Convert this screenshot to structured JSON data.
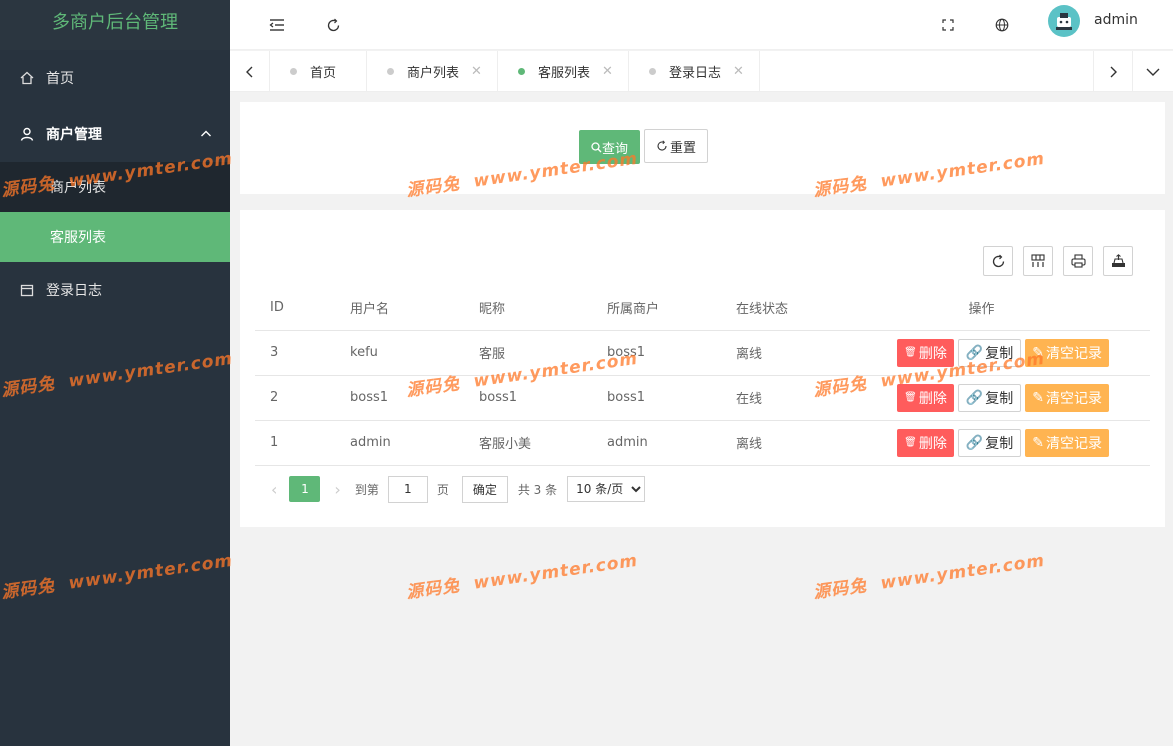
{
  "app": {
    "title": "多商户后台管理"
  },
  "sidebar": {
    "items": [
      {
        "label": "首页",
        "icon": "home-icon"
      },
      {
        "label": "商户管理",
        "icon": "user-icon",
        "expanded": true,
        "children": [
          {
            "label": "商户列表"
          },
          {
            "label": "客服列表",
            "active": true
          }
        ]
      },
      {
        "label": "登录日志",
        "icon": "calendar-icon"
      }
    ]
  },
  "header": {
    "username": "admin"
  },
  "tabs": [
    {
      "label": "首页",
      "closable": false
    },
    {
      "label": "商户列表",
      "closable": true
    },
    {
      "label": "客服列表",
      "closable": true,
      "active": true
    },
    {
      "label": "登录日志",
      "closable": true
    }
  ],
  "search": {
    "query_label": "查询",
    "reset_label": "重置"
  },
  "table": {
    "columns": [
      "ID",
      "用户名",
      "昵称",
      "所属商户",
      "在线状态",
      "操作"
    ],
    "rows": [
      {
        "id": "3",
        "username": "kefu",
        "nickname": "客服",
        "merchant": "boss1",
        "status": "离线"
      },
      {
        "id": "2",
        "username": "boss1",
        "nickname": "boss1",
        "merchant": "boss1",
        "status": "在线"
      },
      {
        "id": "1",
        "username": "admin",
        "nickname": "客服小美",
        "merchant": "admin",
        "status": "离线"
      }
    ],
    "actions": {
      "delete": "删除",
      "copy": "复制",
      "clear": "清空记录"
    }
  },
  "pager": {
    "current": "1",
    "goto_label": "到第",
    "page_input": "1",
    "page_unit": "页",
    "confirm_label": "确定",
    "total_label": "共 3 条",
    "page_size": "10 条/页"
  },
  "watermark": {
    "brand": "源码兔",
    "url": "www.ymter.com"
  },
  "colors": {
    "accent": "#5fb878",
    "sidebar": "#28333e",
    "danger": "#ff5c5c",
    "warning": "#ffb451"
  }
}
